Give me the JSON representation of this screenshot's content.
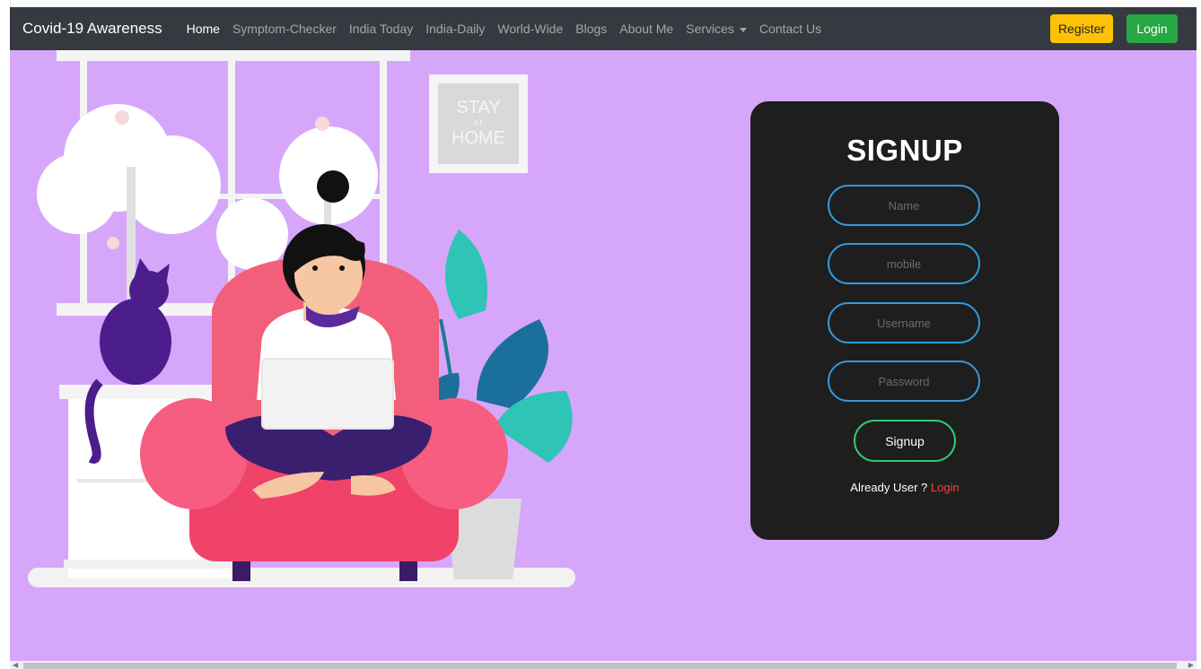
{
  "navbar": {
    "brand": "Covid-19 Awareness",
    "links": [
      "Home",
      "Symptom-Checker",
      "India Today",
      "India-Daily",
      "World-Wide",
      "Blogs",
      "About Me",
      "Services",
      "Contact Us"
    ],
    "register_label": "Register",
    "login_label": "Login"
  },
  "illustration": {
    "sign_line1": "STAY",
    "sign_line2": "AT",
    "sign_line3": "HOME"
  },
  "signup": {
    "title": "SIGNUP",
    "name_placeholder": "Name",
    "mobile_placeholder": "mobile",
    "username_placeholder": "Username",
    "password_placeholder": "Password",
    "button_label": "Signup",
    "already_text": "Already User ? ",
    "login_link": "Login"
  },
  "colors": {
    "background": "#d6a6fb",
    "navbar": "#343a40",
    "register": "#ffc107",
    "login": "#28a745",
    "card": "#1e1e1e",
    "field_border": "#3498db",
    "button_border": "#2ecc71",
    "link": "#e74c3c"
  }
}
